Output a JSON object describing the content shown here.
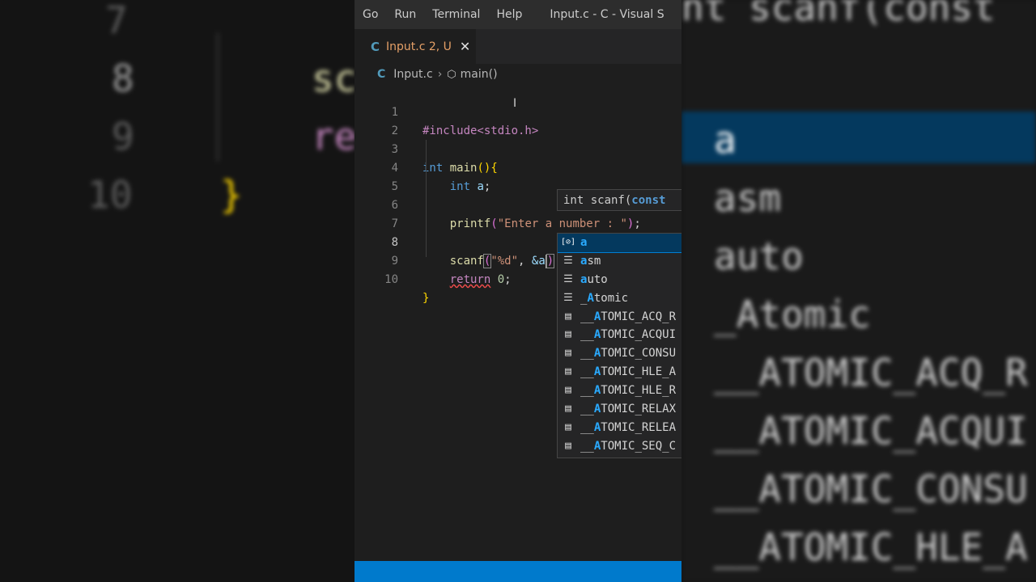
{
  "background_left": {
    "line_numbers": [
      "7",
      "8",
      "9",
      "10"
    ],
    "code_fragments": [
      "sc",
      "re",
      "}"
    ]
  },
  "background_right": {
    "top_fragment": "nt scanf(const",
    "items": [
      "a",
      "asm",
      "auto",
      "_Atomic",
      "__ATOMIC_ACQ_R",
      "__ATOMIC_ACQUI",
      "__ATOMIC_CONSU",
      "__ATOMIC_HLE_A"
    ]
  },
  "menubar": {
    "items": [
      "Go",
      "Run",
      "Terminal",
      "Help"
    ],
    "window_title": "Input.c - C - Visual S"
  },
  "tab": {
    "icon": "C",
    "label": "Input.c 2, U",
    "close": "✕"
  },
  "breadcrumb": {
    "icon": "C",
    "file": "Input.c",
    "symbol": "main()"
  },
  "code": {
    "line_numbers": [
      "1",
      "2",
      "3",
      "4",
      "5",
      "6",
      "7",
      "8",
      "9",
      "10"
    ],
    "line1": "#include<stdio.h>",
    "line3_kw": "int",
    "line3_fn": "main",
    "line4_kw": "int",
    "line4_var": "a",
    "line6_fn": "printf",
    "line6_str": "\"Enter a number : \"",
    "line8_fn": "scanf",
    "line8_str": "\"%d\"",
    "line8_arg": "&a",
    "line9_kw": "return",
    "line9_num": "0"
  },
  "signature_hint": {
    "prefix": "int scanf(",
    "keyword": "const"
  },
  "suggestions": [
    {
      "icon": "variable-icon",
      "label": "a",
      "selected": true
    },
    {
      "icon": "keyword-icon",
      "label": "asm"
    },
    {
      "icon": "keyword-icon",
      "label": "auto"
    },
    {
      "icon": "keyword-icon",
      "label": "_Atomic"
    },
    {
      "icon": "constant-icon",
      "label": "__ATOMIC_ACQ_R"
    },
    {
      "icon": "constant-icon",
      "label": "__ATOMIC_ACQUI"
    },
    {
      "icon": "constant-icon",
      "label": "__ATOMIC_CONSU"
    },
    {
      "icon": "constant-icon",
      "label": "__ATOMIC_HLE_A"
    },
    {
      "icon": "constant-icon",
      "label": "__ATOMIC_HLE_R"
    },
    {
      "icon": "constant-icon",
      "label": "__ATOMIC_RELAX"
    },
    {
      "icon": "constant-icon",
      "label": "__ATOMIC_RELEA"
    },
    {
      "icon": "constant-icon",
      "label": "__ATOMIC_SEQ_C"
    }
  ],
  "colors": {
    "accent": "#007acc",
    "selection": "#04395e",
    "match_highlight": "#2aaaff"
  }
}
